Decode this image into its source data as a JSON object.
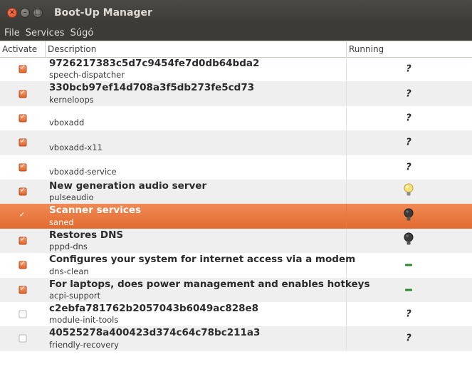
{
  "window": {
    "title": "Boot-Up Manager"
  },
  "menu": [
    "File",
    "Services",
    "Súgó"
  ],
  "columns": {
    "activate": "Activate",
    "description": "Description",
    "running": "Running"
  },
  "rows": [
    {
      "name": "9726217383c5d7c9454fe7d0db64bda2",
      "service": "speech-dispatcher",
      "active": true,
      "running": "unknown",
      "running_symbol": "?"
    },
    {
      "name": "330bcb97ef14d708a3f5db273fe5cd73",
      "service": "kerneloops",
      "active": true,
      "running": "unknown",
      "running_symbol": "?"
    },
    {
      "name": "",
      "service": "vboxadd",
      "active": true,
      "running": "unknown",
      "running_symbol": "?"
    },
    {
      "name": "",
      "service": "vboxadd-x11",
      "active": true,
      "running": "unknown",
      "running_symbol": "?"
    },
    {
      "name": "",
      "service": "vboxadd-service",
      "active": true,
      "running": "unknown",
      "running_symbol": "?"
    },
    {
      "name": "New generation audio server",
      "service": "pulseaudio",
      "active": true,
      "running": "running",
      "icon": "lightbulb-on-icon"
    },
    {
      "name": "Scanner services",
      "service": "saned",
      "active": true,
      "running": "stopped",
      "icon": "lightbulb-off-icon",
      "selected": true
    },
    {
      "name": "Restores DNS",
      "service": "pppd-dns",
      "active": true,
      "running": "stopped",
      "icon": "lightbulb-off-icon"
    },
    {
      "name": "Configures your system for internet access via a modem",
      "service": "dns-clean",
      "active": true,
      "running": "none",
      "icon": "dash-icon"
    },
    {
      "name": "For laptops, does  power management and enables hotkeys",
      "service": "acpi-support",
      "active": true,
      "running": "none",
      "icon": "dash-icon"
    },
    {
      "name": "c2ebfa781762b2057043b6049ac828e8",
      "service": "module-init-tools",
      "active": false,
      "running": "unknown",
      "running_symbol": "?"
    },
    {
      "name": "40525278a400423d374c64c78bc211a3",
      "service": "friendly-recovery",
      "active": false,
      "running": "unknown",
      "running_symbol": "?"
    }
  ],
  "colors": {
    "accent": "#e26a2e",
    "titlebar": "#3c3b37",
    "close_button": "#df4b1f",
    "dash": "#2e8a2e"
  }
}
